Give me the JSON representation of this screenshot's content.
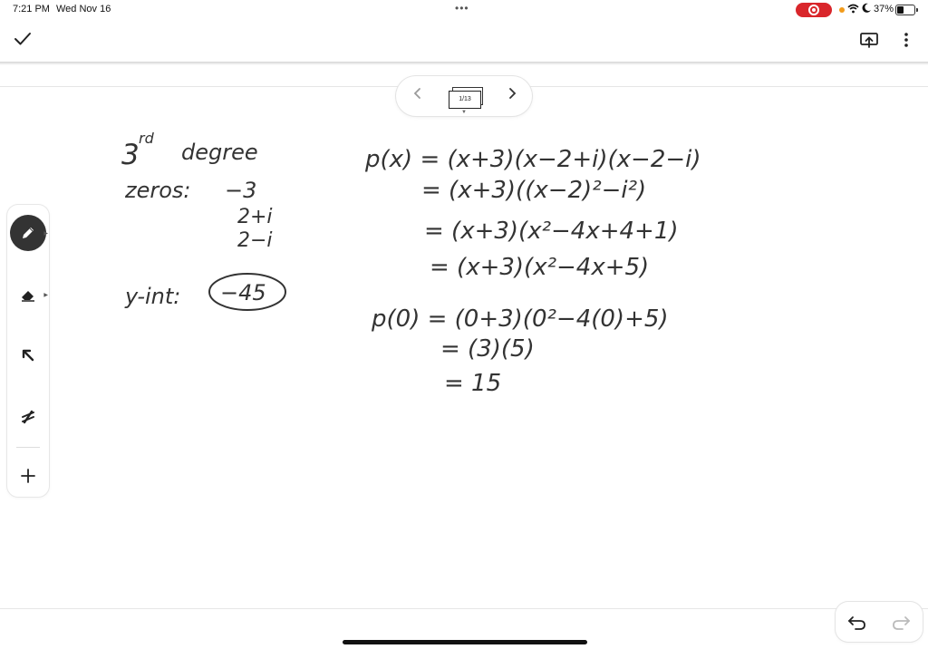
{
  "status_bar": {
    "time": "7:21 PM",
    "date": "Wed Nov 16",
    "multitask_dots": "•••",
    "battery_percent": "37%",
    "battery_level": 0.37,
    "record_color": "#d9262b"
  },
  "toolbar": {
    "done_icon": "checkmark-icon",
    "present_icon": "present-screen-icon",
    "more_icon": "vertical-ellipsis-icon"
  },
  "pager": {
    "page_indicator": "1/13",
    "prev_icon": "chevron-left-icon",
    "next_icon": "chevron-right-icon"
  },
  "tools": [
    {
      "name": "pen",
      "icon": "pen-icon",
      "selected": true
    },
    {
      "name": "eraser",
      "icon": "eraser-icon",
      "selected": false
    },
    {
      "name": "select",
      "icon": "arrow-select-icon",
      "selected": false
    },
    {
      "name": "laser",
      "icon": "laser-pointer-icon",
      "selected": false
    },
    {
      "name": "add",
      "icon": "plus-icon",
      "selected": false
    }
  ],
  "bottom": {
    "undo_icon": "undo-icon",
    "redo_icon": "redo-icon"
  },
  "handwriting": {
    "left": {
      "title": "3rd degree",
      "zeros_label": "zeros:",
      "zeros": [
        "−3",
        "2+i",
        "2−i"
      ],
      "yint_label": "y-int:",
      "yint_value": "−45"
    },
    "right": [
      "p(x) = (x+3)(x−2+i)(x−2−i)",
      "= (x+3)((x−2)²−i²)",
      "= (x+3)(x²−4x+4+1)",
      "= (x+3)(x²−4x+5)",
      "p(0) = (0+3)(0²−4(0)+5)",
      "= (3)(5)",
      "= 15"
    ]
  }
}
